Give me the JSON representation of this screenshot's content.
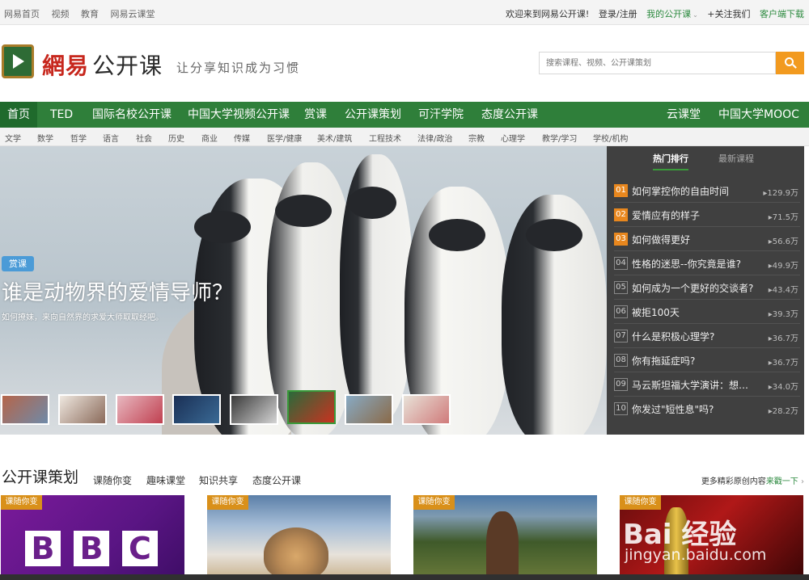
{
  "topbar": {
    "left_links": [
      "网易首页",
      "视频",
      "教育",
      "网易云课堂"
    ],
    "welcome": "欢迎来到网易公开课!",
    "login": "登录/注册",
    "my_course": "我的公开课",
    "follow": "+关注我们",
    "download": "客户端下载"
  },
  "header": {
    "brand_red": "網易",
    "brand_black": "公开课",
    "slogan": "让分享知识成为习惯",
    "search_placeholder": "搜索课程、视频、公开课策划",
    "logo_icon": "play-icon",
    "search_icon": "search-icon"
  },
  "nav": {
    "items": [
      "首页",
      "TED",
      "国际名校公开课",
      "中国大学视频公开课",
      "赏课",
      "公开课策划",
      "可汗学院",
      "态度公开课"
    ],
    "right_items": [
      "云课堂",
      "中国大学MOOC"
    ]
  },
  "subnav": [
    "文学",
    "数学",
    "哲学",
    "语言",
    "社会",
    "历史",
    "商业",
    "传媒",
    "医学/健康",
    "美术/建筑",
    "工程技术",
    "法律/政治",
    "宗教",
    "心理学",
    "教学/学习",
    "学校/机构"
  ],
  "banner": {
    "badge": "赏课",
    "title": "谁是动物界的爱情导师？",
    "subtitle": "如何撩妹，来向自然界的求爱大师取取经吧。",
    "thumb_count": 8,
    "selected_thumb": 4
  },
  "ranking": {
    "tab_hot": "热门排行",
    "tab_new": "最新课程",
    "items": [
      {
        "num": "01",
        "title": "如何掌控你的自由时间",
        "count": "129.9万",
        "hot": true
      },
      {
        "num": "02",
        "title": "爱情应有的样子",
        "count": "71.5万",
        "hot": true
      },
      {
        "num": "03",
        "title": "如何做得更好",
        "count": "56.6万",
        "hot": true
      },
      {
        "num": "04",
        "title": "性格的迷思--你究竟是谁?",
        "count": "49.9万",
        "hot": false
      },
      {
        "num": "05",
        "title": "如何成为一个更好的交谈者?",
        "count": "43.4万",
        "hot": false
      },
      {
        "num": "06",
        "title": "被拒100天",
        "count": "39.3万",
        "hot": false
      },
      {
        "num": "07",
        "title": "什么是积极心理学?",
        "count": "36.7万",
        "hot": false
      },
      {
        "num": "08",
        "title": "你有拖延症吗?",
        "count": "36.7万",
        "hot": false
      },
      {
        "num": "09",
        "title": "马云斯坦福大学演讲：想…",
        "count": "34.0万",
        "hot": false
      },
      {
        "num": "10",
        "title": "你发过\"短性息\"吗?",
        "count": "28.2万",
        "hot": false
      }
    ]
  },
  "section": {
    "heading": "公开课策划",
    "tabs": [
      "课随你变",
      "趣味课堂",
      "知识共享",
      "态度公开课"
    ],
    "more_text": "更多精彩原创内容",
    "more_link": "来戳一下",
    "cards": [
      {
        "tag": "课随你变"
      },
      {
        "tag": "课随你变"
      },
      {
        "tag": "课随你变"
      },
      {
        "tag": "课随你变"
      }
    ],
    "bbc_letters": [
      "B",
      "B",
      "C"
    ]
  },
  "watermark": {
    "line1": "Bai 经验",
    "line2": "jingyan.baidu.com"
  },
  "colors": {
    "nav_green": "#2f7f3a",
    "search_orange": "#f29a1f",
    "rank_bg": "#404040",
    "hot_orange": "#e8871e",
    "tag_orange": "#d9901a"
  }
}
